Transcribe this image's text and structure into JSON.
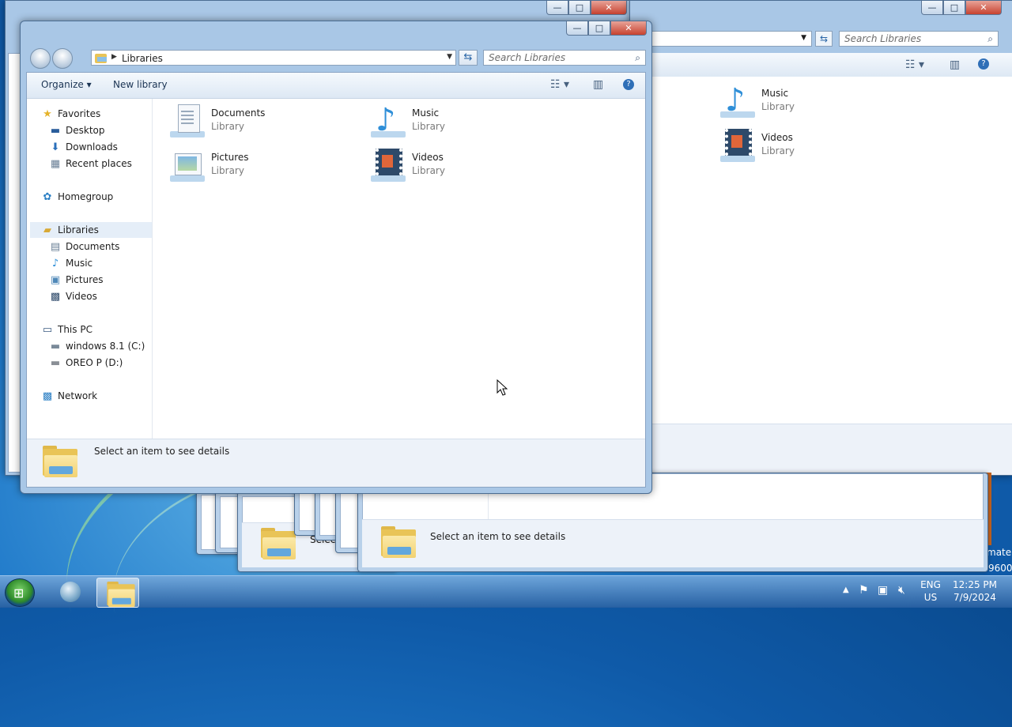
{
  "background_window": {
    "search_placeholder": "Search Libraries",
    "items": [
      {
        "title": "Music",
        "subtitle": "Library"
      },
      {
        "title": "Videos",
        "subtitle": "Library"
      }
    ],
    "partial_text": "mate",
    "partial_text2": "9600"
  },
  "stacked_windows": {
    "details_text": "Select an item to see details",
    "partial_text": "Selec"
  },
  "main_window": {
    "address": {
      "location": "Libraries"
    },
    "search_placeholder": "Search Libraries",
    "toolbar": {
      "organize": "Organize",
      "new_library": "New library"
    },
    "nav": {
      "favorites": "Favorites",
      "desktop": "Desktop",
      "downloads": "Downloads",
      "recent_places": "Recent places",
      "homegroup": "Homegroup",
      "libraries": "Libraries",
      "documents": "Documents",
      "music": "Music",
      "pictures": "Pictures",
      "videos": "Videos",
      "this_pc": "This PC",
      "drive_c": "windows 8.1 (C:)",
      "drive_d": "OREO P (D:)",
      "network": "Network"
    },
    "libraries": [
      {
        "title": "Documents",
        "subtitle": "Library"
      },
      {
        "title": "Music",
        "subtitle": "Library"
      },
      {
        "title": "Pictures",
        "subtitle": "Library"
      },
      {
        "title": "Videos",
        "subtitle": "Library"
      }
    ],
    "details_text": "Select an item to see details"
  },
  "taskbar": {
    "language": "ENG",
    "region": "US",
    "time": "12:25 PM",
    "date": "7/9/2024"
  }
}
